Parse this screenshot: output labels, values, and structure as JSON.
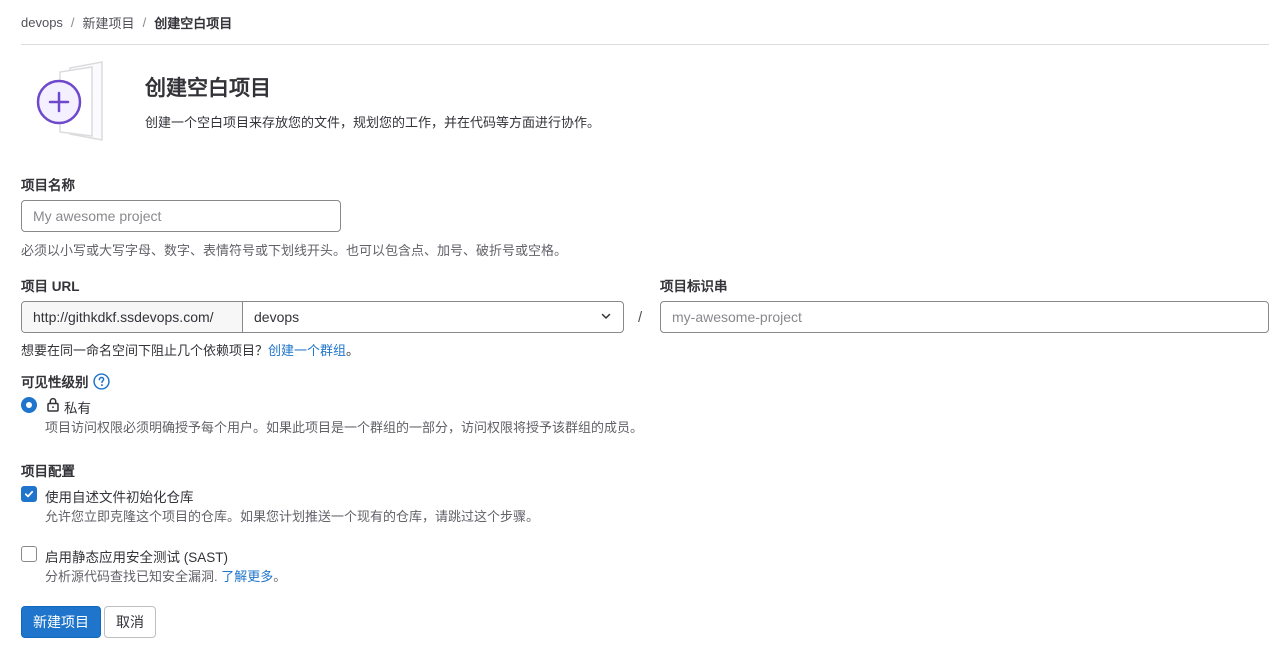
{
  "breadcrumb": {
    "items": [
      "devops",
      "新建项目"
    ],
    "current": "创建空白项目",
    "separator": "/"
  },
  "hero": {
    "title": "创建空白项目",
    "description": "创建一个空白项目来存放您的文件，规划您的工作，并在代码等方面进行协作。"
  },
  "project_name": {
    "label": "项目名称",
    "placeholder": "My awesome project",
    "help": "必须以小写或大写字母、数字、表情符号或下划线开头。也可以包含点、加号、破折号或空格。"
  },
  "project_url": {
    "label": "项目 URL",
    "prefix": "http://githkdkf.ssdevops.com/",
    "namespace": "devops",
    "help_text": "想要在同一命名空间下阻止几个依赖项目？",
    "help_link": "创建一个群组",
    "help_suffix": "。"
  },
  "slug": {
    "separator": "/",
    "label": "项目标识串",
    "placeholder": "my-awesome-project"
  },
  "visibility": {
    "label": "可见性级别",
    "option_label": "私有",
    "option_help": "项目访问权限必须明确授予每个用户。如果此项目是一个群组的一部分，访问权限将授予该群组的成员。"
  },
  "config": {
    "label": "项目配置",
    "readme": {
      "label": "使用自述文件初始化仓库",
      "help": "允许您立即克隆这个项目的仓库。如果您计划推送一个现有的仓库，请跳过这个步骤。",
      "checked": true
    },
    "sast": {
      "label": "启用静态应用安全测试 (SAST)",
      "help": "分析源代码查找已知安全漏洞.",
      "link": "了解更多",
      "suffix": "。",
      "checked": false
    }
  },
  "buttons": {
    "create": "新建项目",
    "cancel": "取消"
  },
  "colors": {
    "accent": "#1f75cb",
    "illustration": "#6e49cb"
  }
}
